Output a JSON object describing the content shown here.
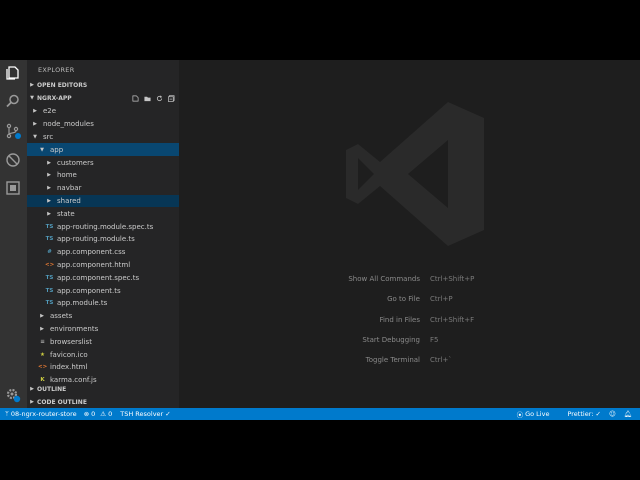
{
  "sidebar": {
    "title": "EXPLORER",
    "open_editors": "OPEN EDITORS",
    "project": "NGRX-APP",
    "outline": "OUTLINE",
    "code_outline": "CODE OUTLINE",
    "tree": [
      {
        "label": "e2e",
        "type": "folder",
        "depth": 1,
        "expanded": false
      },
      {
        "label": "node_modules",
        "type": "folder",
        "depth": 1,
        "expanded": false
      },
      {
        "label": "src",
        "type": "folder",
        "depth": 1,
        "expanded": true
      },
      {
        "label": "app",
        "type": "folder",
        "depth": 2,
        "expanded": true,
        "state": "active"
      },
      {
        "label": "customers",
        "type": "folder",
        "depth": 3,
        "expanded": false
      },
      {
        "label": "home",
        "type": "folder",
        "depth": 3,
        "expanded": false
      },
      {
        "label": "navbar",
        "type": "folder",
        "depth": 3,
        "expanded": false
      },
      {
        "label": "shared",
        "type": "folder",
        "depth": 3,
        "expanded": false,
        "state": "selected"
      },
      {
        "label": "state",
        "type": "folder",
        "depth": 3,
        "expanded": false
      },
      {
        "label": "app-routing.module.spec.ts",
        "type": "ts",
        "depth": 3
      },
      {
        "label": "app-routing.module.ts",
        "type": "ts",
        "depth": 3
      },
      {
        "label": "app.component.css",
        "type": "css",
        "depth": 3
      },
      {
        "label": "app.component.html",
        "type": "html",
        "depth": 3
      },
      {
        "label": "app.component.spec.ts",
        "type": "ts",
        "depth": 3
      },
      {
        "label": "app.component.ts",
        "type": "ts",
        "depth": 3
      },
      {
        "label": "app.module.ts",
        "type": "ts",
        "depth": 3
      },
      {
        "label": "assets",
        "type": "folder",
        "depth": 2,
        "expanded": false
      },
      {
        "label": "environments",
        "type": "folder",
        "depth": 2,
        "expanded": false
      },
      {
        "label": "browserslist",
        "type": "txt",
        "depth": 2
      },
      {
        "label": "favicon.ico",
        "type": "fav",
        "depth": 2
      },
      {
        "label": "index.html",
        "type": "html",
        "depth": 2
      },
      {
        "label": "karma.conf.js",
        "type": "js",
        "depth": 2
      }
    ],
    "icon_glyphs": {
      "ts": "TS",
      "css": "#",
      "html": "<>",
      "txt": "≡",
      "fav": "★",
      "js": "K"
    }
  },
  "shortcuts": [
    {
      "label": "Show All Commands",
      "key": "Ctrl+Shift+P"
    },
    {
      "label": "Go to File",
      "key": "Ctrl+P"
    },
    {
      "label": "Find in Files",
      "key": "Ctrl+Shift+F"
    },
    {
      "label": "Start Debugging",
      "key": "F5"
    },
    {
      "label": "Toggle Terminal",
      "key": "Ctrl+`"
    }
  ],
  "statusbar": {
    "branch": "08-ngrx-router-store",
    "errors": "0",
    "warnings": "0",
    "tslint": "TSH Resolver ✓",
    "go_live": "Go Live",
    "prettier": "Prettier: ✓",
    "accent": "#007acc"
  },
  "activity": {
    "icons": [
      "files-icon",
      "search-icon",
      "source-control-icon",
      "extensions-blocked-icon",
      "extensions-icon"
    ],
    "badge": "1"
  }
}
